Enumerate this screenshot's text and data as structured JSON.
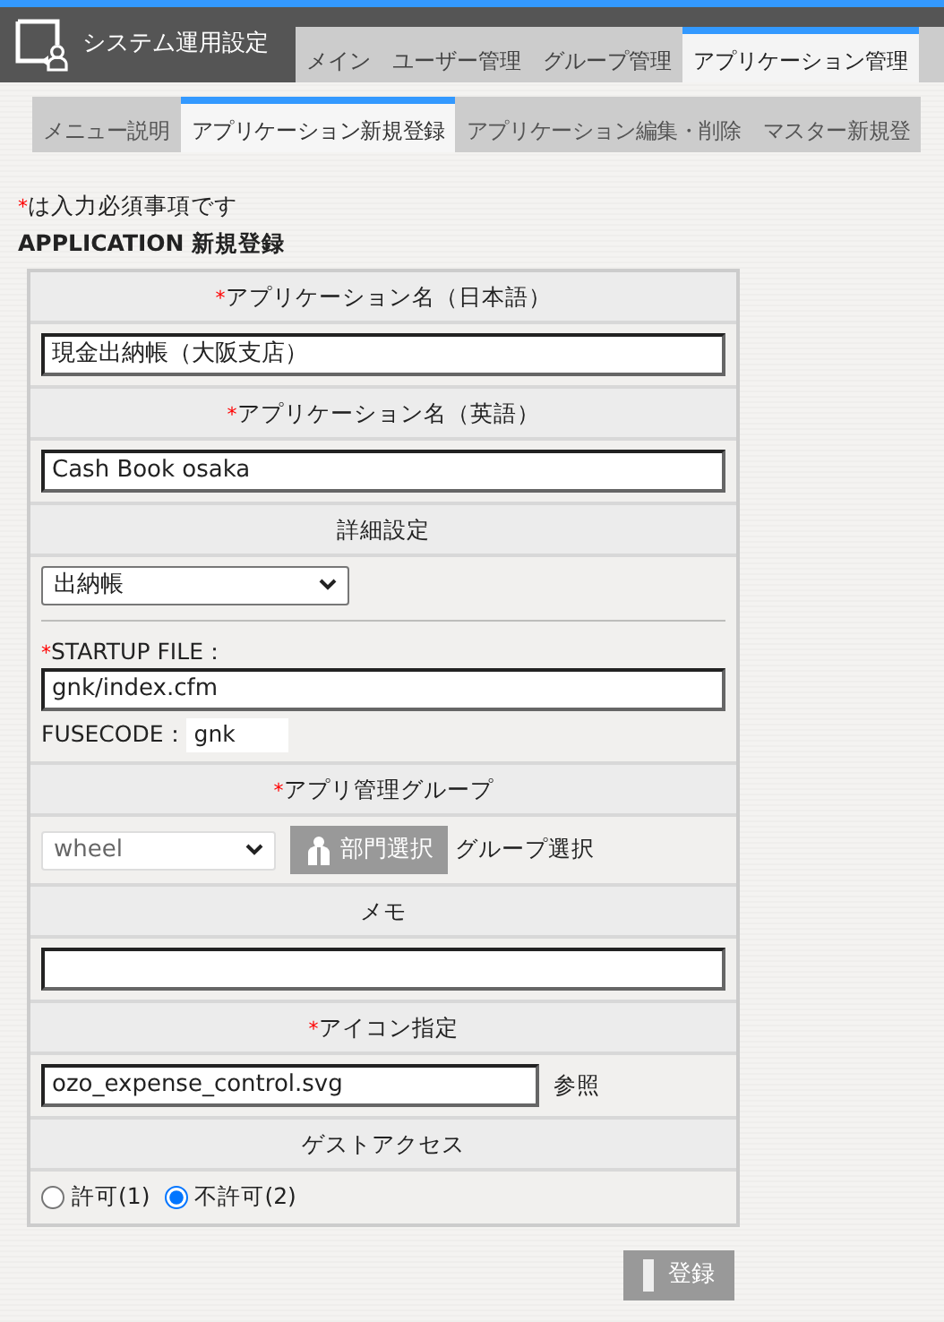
{
  "app": {
    "title": "システム運用設定"
  },
  "main_tabs": [
    {
      "label": "メイン",
      "selected": false
    },
    {
      "label": "ユーザー管理",
      "selected": false
    },
    {
      "label": "グループ管理",
      "selected": false
    },
    {
      "label": "アプリケーション管理",
      "selected": true
    }
  ],
  "sub_tabs": [
    {
      "label": "メニュー説明",
      "selected": false
    },
    {
      "label": "アプリケーション新規登録",
      "selected": true
    },
    {
      "label": "アプリケーション編集・削除",
      "selected": false
    },
    {
      "label": "マスター新規登",
      "selected": false
    }
  ],
  "required_note": {
    "mark": "*",
    "text": "は入力必須事項です"
  },
  "form_title": "APPLICATION 新規登録",
  "rows": [
    {
      "kind": "header",
      "mark": "*",
      "label": "アプリケーション名（日本語）"
    },
    {
      "kind": "input",
      "value": "現金出納帳（大阪支店）"
    },
    {
      "kind": "header",
      "mark": "*",
      "label": "アプリケーション名（英語）"
    },
    {
      "kind": "input",
      "value": "Cash Book osaka"
    },
    {
      "kind": "header",
      "label": "詳細設定"
    },
    {
      "kind": "detail",
      "select": "出納帳",
      "mark": "*",
      "label": "STARTUP FILE：",
      "value": "gnk/index.cfm",
      "fusecode_label": "FUSECODE：",
      "fusecode": "gnk"
    },
    {
      "kind": "header",
      "mark": "*",
      "label": "アプリ管理グループ"
    },
    {
      "kind": "group",
      "select": "wheel",
      "disabled": true,
      "button": "部門選択",
      "link": "グループ選択"
    },
    {
      "kind": "header",
      "label": "メモ"
    },
    {
      "kind": "input"
    },
    {
      "kind": "header",
      "mark": "*",
      "label": "アイコン指定"
    },
    {
      "kind": "file",
      "value": "ozo_expense_control.svg",
      "browse": "参照"
    },
    {
      "kind": "header",
      "label": "ゲストアクセス"
    },
    {
      "kind": "radios",
      "options": [
        {
          "label": "許可(1)",
          "selected": false
        },
        {
          "label": "不許可(2)",
          "selected": true
        }
      ]
    }
  ],
  "submit": "登録"
}
